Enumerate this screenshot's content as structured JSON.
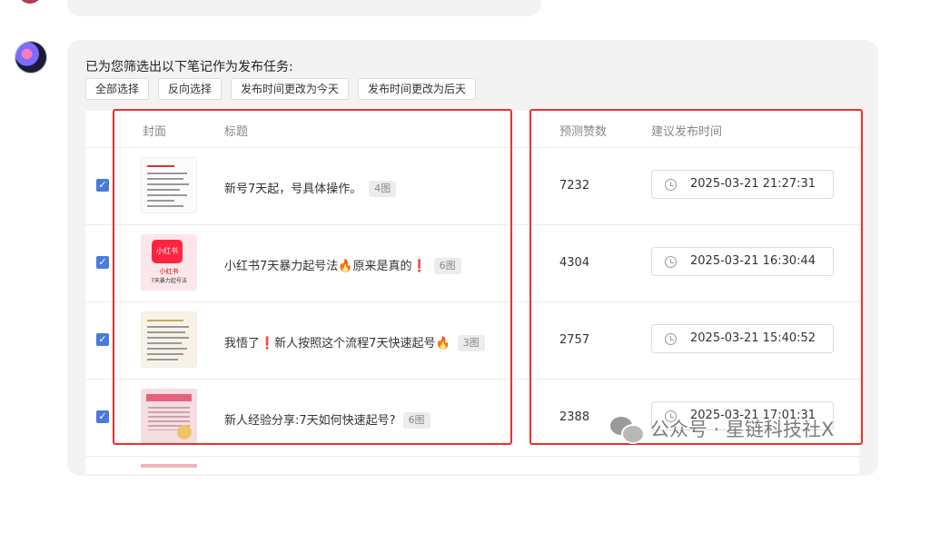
{
  "message": {
    "heading": "已为您筛选出以下笔记作为发布任务:",
    "buttons": {
      "select_all": "全部选择",
      "invert": "反向选择",
      "set_today": "发布时间更改为今天",
      "set_day_after": "发布时间更改为后天"
    }
  },
  "table": {
    "columns": {
      "cover": "封面",
      "title": "标题",
      "likes": "预测赞数",
      "time": "建议发布时间"
    },
    "rows": [
      {
        "checked": true,
        "cover_icon": "document-thumbnail",
        "title": "新号7天起，号具体操作。",
        "tag": "4图",
        "likes": "7232",
        "time": "2025-03-21 21:27:31"
      },
      {
        "checked": true,
        "cover_icon": "xiaohongshu-logo-thumbnail",
        "cover_badge": "小红书",
        "cover_line1": "小红书",
        "cover_line2": "7天暴力起号法",
        "title": "小红书7天暴力起号法🔥原来是真的❗",
        "tag": "6图",
        "likes": "4304",
        "time": "2025-03-21 16:30:44"
      },
      {
        "checked": true,
        "cover_icon": "document-thumbnail",
        "title": "我悟了❗新人按照这个流程7天快速起号🔥",
        "tag": "3图",
        "likes": "2757",
        "time": "2025-03-21 15:40:52"
      },
      {
        "checked": true,
        "cover_icon": "pink-poster-thumbnail",
        "title": "新人经验分享:7天如何快速起号?",
        "tag": "6图",
        "likes": "2388",
        "time": "2025-03-21 17:01:31"
      }
    ]
  },
  "watermark": {
    "text": "公众号 · 星链科技社X"
  },
  "colors": {
    "accent_checkbox": "#4a7bdc",
    "highlight": "#e8312e",
    "brand_red": "#ff2442"
  }
}
